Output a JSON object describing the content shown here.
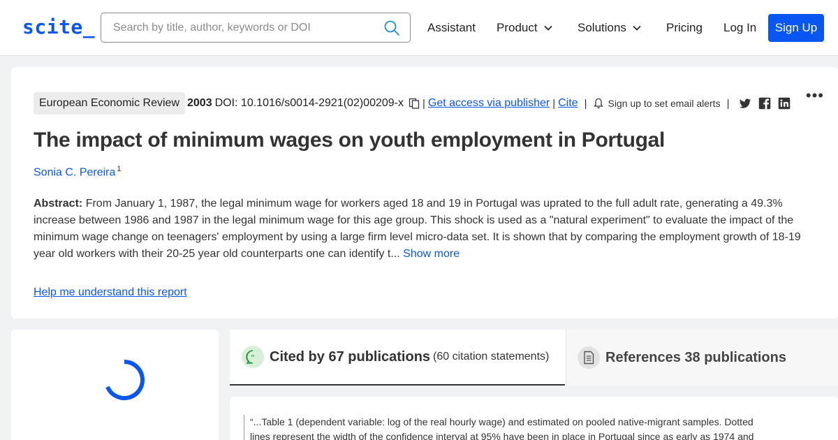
{
  "header": {
    "logo": "scite_",
    "search_placeholder": "Search by title, author, keywords or DOI",
    "nav": {
      "assistant": "Assistant",
      "product": "Product",
      "solutions": "Solutions",
      "pricing": "Pricing",
      "login": "Log In",
      "signup": "Sign Up"
    }
  },
  "paper": {
    "journal": "European Economic Review",
    "year": "2003",
    "doi": "DOI: 10.1016/s0014-2921(02)00209-x",
    "access_link": "Get access via publisher",
    "cite_link": "Cite",
    "alerts": "Sign up to set email alerts",
    "title": "The impact of minimum wages on youth employment in Portugal",
    "author": "Sonia C. Pereira",
    "author_sup": "1",
    "abstract_label": "Abstract:",
    "abstract_text": "From January 1, 1987, the legal minimum wage for workers aged 18 and 19 in Portugal was uprated to the full adult rate, generating a 49.3% increase between 1986 and 1987 in the legal minimum wage for this age group. This shock is used as a \"natural experiment\" to evaluate the impact of the minimum wage change on teenagers' employment by using a large firm level micro-data set. It is shown that by comparing the employment growth of 18-19 year old workers with their 20-25 year old counterparts one can identify t...",
    "show_more": "Show more",
    "help_link": "Help me understand this report",
    "separator": "|",
    "more_menu": "•••"
  },
  "tabs": {
    "cited_main": "Cited by 67 publications",
    "cited_sub": "(60 citation statements)",
    "refs_main": "References 38 publications"
  },
  "citation": {
    "text": "“...Table 1 (dependent variable: log of the real hourly wage) and estimated on pooled native-migrant samples. Dotted lines represent the width of the confidence interval at 95% have been in place in Portugal since as early as 1974 and"
  },
  "colors": {
    "brand": "#0a56f3",
    "cited_icon_bg": "#d8f0d8",
    "cited_icon": "#2e9a46",
    "refs_icon_bg": "#e2e2e2"
  },
  "icons": [
    "search-icon",
    "chevron-down-icon",
    "copy-icon",
    "bell-icon",
    "twitter-icon",
    "facebook-icon",
    "linkedin-icon",
    "more-icon",
    "spinner-icon",
    "quote-bubble-icon",
    "document-icon"
  ]
}
